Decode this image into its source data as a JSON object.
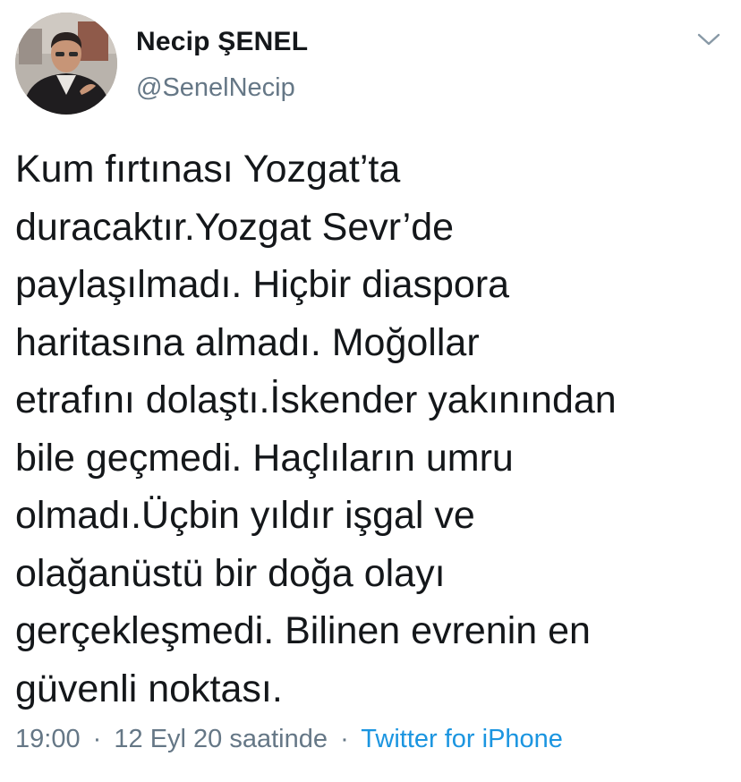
{
  "author": {
    "name": "Necip ŞENEL",
    "handle": "@SenelNecip"
  },
  "tweet": {
    "lines": [
      "Kum fırtınası Yozgat’ta",
      "duracaktır.Yozgat Sevr’de",
      "paylaşılmadı. Hiçbir diaspora",
      "haritasına almadı. Moğollar",
      "etrafını dolaştı.İskender yakınından",
      "bile geçmedi. Haçlıların umru",
      "olmadı.Üçbin yıldır işgal ve",
      "olağanüstü bir doğa olayı",
      "gerçekleşmedi. Bilinen evrenin en",
      "güvenli noktası."
    ]
  },
  "meta": {
    "time": "19:00",
    "separator": "·",
    "date": "12 Eyl 20 saatinde",
    "source": "Twitter for iPhone"
  },
  "icons": {
    "menu": "chevron-down-icon",
    "avatar": "profile-photo"
  },
  "colors": {
    "text": "#14171a",
    "secondary": "#657786",
    "link": "#1b95e0",
    "background": "#ffffff"
  }
}
